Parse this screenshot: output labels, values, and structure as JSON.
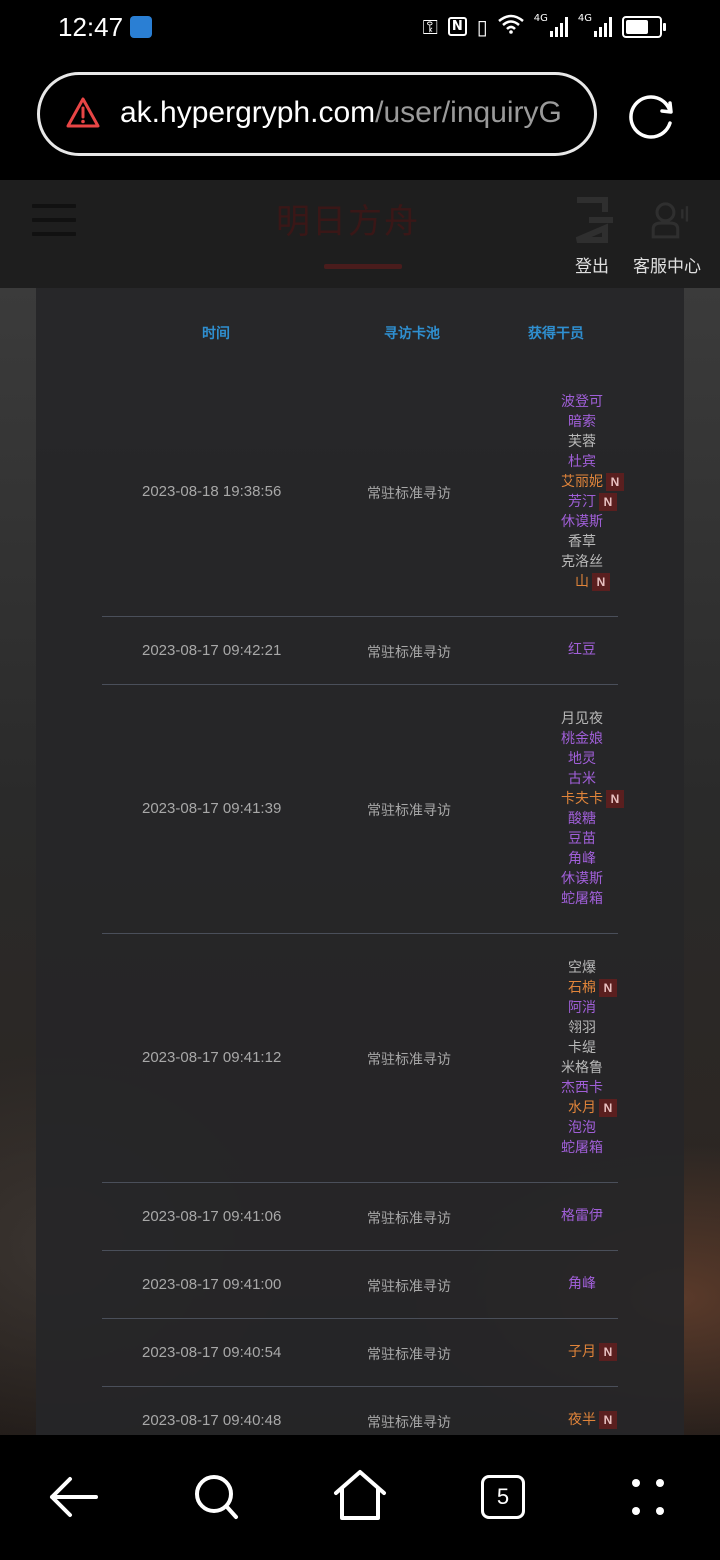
{
  "status_bar": {
    "time": "12:47",
    "network_label": "4G",
    "battery_percent": 80
  },
  "browser": {
    "url_host": "ak.hypergryph.com",
    "url_path": "/user/inquiryG",
    "tab_count": "5"
  },
  "header": {
    "logo_text": "明日方舟",
    "logout_label": "登出",
    "service_label": "客服中心"
  },
  "table": {
    "headers": {
      "time": "时间",
      "pool": "寻访卡池",
      "operators": "获得干员"
    },
    "colors": {
      "white": "#b8b8b8",
      "purple": "#a05fd8",
      "orange": "#e0843a",
      "header": "#2f8fd0",
      "badge_bg": "#5a1f1f"
    },
    "badge_text": "N",
    "rows": [
      {
        "time": "2023-08-18 19:38:56",
        "pool": "常驻标准寻访",
        "operators": [
          {
            "name": "波登可",
            "rarity": "purple",
            "new": false
          },
          {
            "name": "暗索",
            "rarity": "purple",
            "new": false
          },
          {
            "name": "芙蓉",
            "rarity": "white",
            "new": false
          },
          {
            "name": "杜宾",
            "rarity": "purple",
            "new": false
          },
          {
            "name": "艾丽妮",
            "rarity": "orange",
            "new": true
          },
          {
            "name": "芳汀",
            "rarity": "purple",
            "new": true
          },
          {
            "name": "休谟斯",
            "rarity": "purple",
            "new": false
          },
          {
            "name": "香草",
            "rarity": "white",
            "new": false
          },
          {
            "name": "克洛丝",
            "rarity": "white",
            "new": false
          },
          {
            "name": "山",
            "rarity": "orange",
            "new": true
          }
        ]
      },
      {
        "time": "2023-08-17 09:42:21",
        "pool": "常驻标准寻访",
        "operators": [
          {
            "name": "红豆",
            "rarity": "purple",
            "new": false
          }
        ]
      },
      {
        "time": "2023-08-17 09:41:39",
        "pool": "常驻标准寻访",
        "operators": [
          {
            "name": "月见夜",
            "rarity": "white",
            "new": false
          },
          {
            "name": "桃金娘",
            "rarity": "purple",
            "new": false
          },
          {
            "name": "地灵",
            "rarity": "purple",
            "new": false
          },
          {
            "name": "古米",
            "rarity": "purple",
            "new": false
          },
          {
            "name": "卡夫卡",
            "rarity": "orange",
            "new": true
          },
          {
            "name": "酸糖",
            "rarity": "purple",
            "new": false
          },
          {
            "name": "豆苗",
            "rarity": "purple",
            "new": false
          },
          {
            "name": "角峰",
            "rarity": "purple",
            "new": false
          },
          {
            "name": "休谟斯",
            "rarity": "purple",
            "new": false
          },
          {
            "name": "蛇屠箱",
            "rarity": "purple",
            "new": false
          }
        ]
      },
      {
        "time": "2023-08-17 09:41:12",
        "pool": "常驻标准寻访",
        "operators": [
          {
            "name": "空爆",
            "rarity": "white",
            "new": false
          },
          {
            "name": "石棉",
            "rarity": "orange",
            "new": true
          },
          {
            "name": "阿消",
            "rarity": "purple",
            "new": false
          },
          {
            "name": "翎羽",
            "rarity": "white",
            "new": false
          },
          {
            "name": "卡缇",
            "rarity": "white",
            "new": false
          },
          {
            "name": "米格鲁",
            "rarity": "white",
            "new": false
          },
          {
            "name": "杰西卡",
            "rarity": "purple",
            "new": false
          },
          {
            "name": "水月",
            "rarity": "orange",
            "new": true
          },
          {
            "name": "泡泡",
            "rarity": "purple",
            "new": false
          },
          {
            "name": "蛇屠箱",
            "rarity": "purple",
            "new": false
          }
        ]
      },
      {
        "time": "2023-08-17 09:41:06",
        "pool": "常驻标准寻访",
        "operators": [
          {
            "name": "格雷伊",
            "rarity": "purple",
            "new": false
          }
        ]
      },
      {
        "time": "2023-08-17 09:41:00",
        "pool": "常驻标准寻访",
        "operators": [
          {
            "name": "角峰",
            "rarity": "purple",
            "new": false
          }
        ]
      },
      {
        "time": "2023-08-17 09:40:54",
        "pool": "常驻标准寻访",
        "operators": [
          {
            "name": "子月",
            "rarity": "orange",
            "new": true
          }
        ]
      },
      {
        "time": "2023-08-17 09:40:48",
        "pool": "常驻标准寻访",
        "operators": [
          {
            "name": "夜半",
            "rarity": "orange",
            "new": true
          }
        ]
      }
    ]
  },
  "nav": {
    "back": "back-arrow-icon",
    "search": "search-icon",
    "home": "home-icon",
    "tabs": "tabs-icon",
    "menu": "more-icon"
  }
}
